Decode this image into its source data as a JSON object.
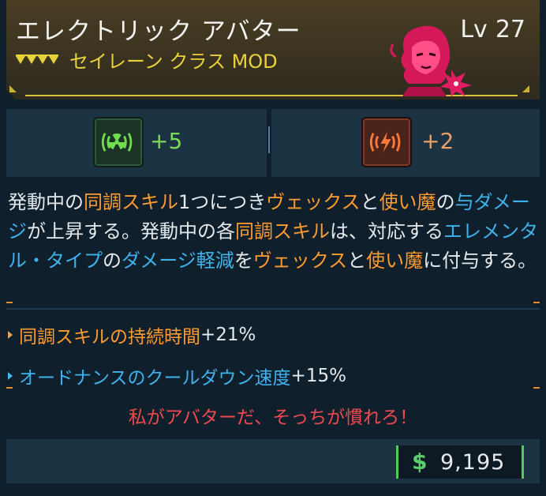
{
  "header": {
    "title": "エレクトリック アバター",
    "subtitle": "セイレーン クラス MOD",
    "level_label": "Lv",
    "level_value": "27"
  },
  "stats": [
    {
      "icon": "radiation-icon",
      "value": "+5",
      "color": "#7ed957"
    },
    {
      "icon": "shock-icon",
      "value": "+2",
      "color": "#e8a067"
    }
  ],
  "description": {
    "segments": [
      {
        "text": "発動中の",
        "style": "w"
      },
      {
        "text": "同調スキル",
        "style": "o"
      },
      {
        "text": "1つにつき",
        "style": "w"
      },
      {
        "text": "ヴェックス",
        "style": "o"
      },
      {
        "text": "と",
        "style": "w"
      },
      {
        "text": "使い魔",
        "style": "o"
      },
      {
        "text": "の",
        "style": "w"
      },
      {
        "text": "与ダメージ",
        "style": "b"
      },
      {
        "text": "が上昇する。発動中の各",
        "style": "w"
      },
      {
        "text": "同調スキル",
        "style": "o"
      },
      {
        "text": "は、対応する",
        "style": "w"
      },
      {
        "text": "エレメンタル・タイプ",
        "style": "b"
      },
      {
        "text": "の",
        "style": "w"
      },
      {
        "text": "ダメージ軽減",
        "style": "b"
      },
      {
        "text": "を",
        "style": "w"
      },
      {
        "text": "ヴェックス",
        "style": "o"
      },
      {
        "text": "と",
        "style": "w"
      },
      {
        "text": "使い魔",
        "style": "o"
      },
      {
        "text": "に付与する。",
        "style": "w"
      }
    ]
  },
  "bullets": [
    {
      "label": "同調スキルの持続時間",
      "value": "+21%",
      "color": "orange"
    },
    {
      "label": "オードナンスのクールダウン速度",
      "value": "+15%",
      "color": "blue"
    }
  ],
  "quote": "私がアバターだ、そっちが慣れろ！",
  "price": {
    "currency_symbol": "$",
    "amount": "9,195"
  },
  "colors": {
    "accent_yellow": "#e8d23c",
    "orange_keyword": "#ff9b2f",
    "blue_keyword": "#3fb2ec",
    "quote_red": "#ee4a4e",
    "money_green": "#5bd06a"
  }
}
